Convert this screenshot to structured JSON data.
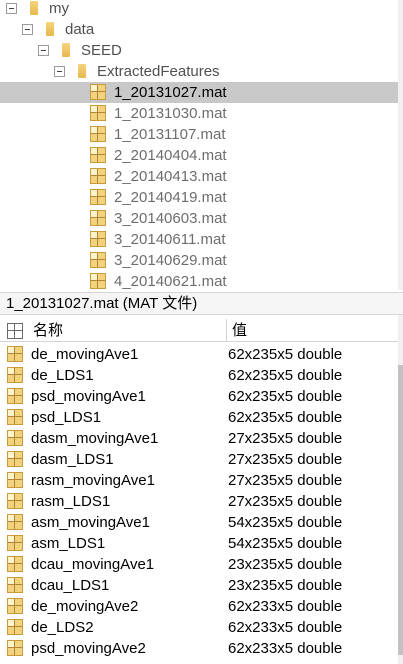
{
  "tree": {
    "nodes": [
      {
        "label": "my",
        "kind": "folder",
        "level": 0
      },
      {
        "label": "data",
        "kind": "folder",
        "level": 1
      },
      {
        "label": "SEED",
        "kind": "folder",
        "level": 2
      },
      {
        "label": "ExtractedFeatures",
        "kind": "folder",
        "level": 3
      },
      {
        "label": "1_20131027.mat",
        "kind": "mat",
        "level": 4,
        "selected": true
      },
      {
        "label": "1_20131030.mat",
        "kind": "mat",
        "level": 4
      },
      {
        "label": "1_20131107.mat",
        "kind": "mat",
        "level": 4
      },
      {
        "label": "2_20140404.mat",
        "kind": "mat",
        "level": 4
      },
      {
        "label": "2_20140413.mat",
        "kind": "mat",
        "level": 4
      },
      {
        "label": "2_20140419.mat",
        "kind": "mat",
        "level": 4
      },
      {
        "label": "3_20140603.mat",
        "kind": "mat",
        "level": 4
      },
      {
        "label": "3_20140611.mat",
        "kind": "mat",
        "level": 4
      },
      {
        "label": "3_20140629.mat",
        "kind": "mat",
        "level": 4
      },
      {
        "label": "4_20140621.mat",
        "kind": "mat",
        "level": 4
      }
    ]
  },
  "details": {
    "title": "1_20131027.mat  (MAT 文件)",
    "col_name": "名称",
    "col_value": "值",
    "rows": [
      {
        "name": "de_movingAve1",
        "value": "62x235x5 double"
      },
      {
        "name": "de_LDS1",
        "value": "62x235x5 double"
      },
      {
        "name": "psd_movingAve1",
        "value": "62x235x5 double"
      },
      {
        "name": "psd_LDS1",
        "value": "62x235x5 double"
      },
      {
        "name": "dasm_movingAve1",
        "value": "27x235x5 double"
      },
      {
        "name": "dasm_LDS1",
        "value": "27x235x5 double"
      },
      {
        "name": "rasm_movingAve1",
        "value": "27x235x5 double"
      },
      {
        "name": "rasm_LDS1",
        "value": "27x235x5 double"
      },
      {
        "name": "asm_movingAve1",
        "value": "54x235x5 double"
      },
      {
        "name": "asm_LDS1",
        "value": "54x235x5 double"
      },
      {
        "name": "dcau_movingAve1",
        "value": "23x235x5 double"
      },
      {
        "name": "dcau_LDS1",
        "value": "23x235x5 double"
      },
      {
        "name": "de_movingAve2",
        "value": "62x233x5 double"
      },
      {
        "name": "de_LDS2",
        "value": "62x233x5 double"
      },
      {
        "name": "psd_movingAve2",
        "value": "62x233x5 double"
      }
    ]
  },
  "colors": {
    "selection": "#c8c8c8",
    "matfile_text": "#6d6d6d",
    "folder_text": "#505050"
  }
}
